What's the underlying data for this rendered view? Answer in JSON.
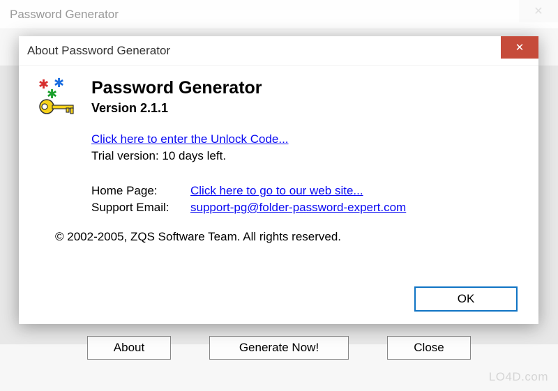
{
  "mainWindow": {
    "title": "Password Generator",
    "closeGlyph": "✕",
    "buttons": {
      "about": "About",
      "generate": "Generate Now!",
      "close": "Close"
    }
  },
  "dialog": {
    "title": "About Password Generator",
    "closeGlyph": "✕",
    "appName": "Password Generator",
    "version": "Version 2.1.1",
    "unlockLink": "Click here to enter the Unlock Code...",
    "trialText": "Trial version: 10 days left.",
    "homePageLabel": "Home Page:",
    "homePageLink": "Click here to go to our web site...",
    "supportLabel": "Support Email:",
    "supportLink": "support-pg@folder-password-expert.com",
    "copyright": "© 2002-2005, ZQS Software Team. All rights reserved.",
    "okLabel": "OK"
  },
  "watermark": "LO4D.com"
}
